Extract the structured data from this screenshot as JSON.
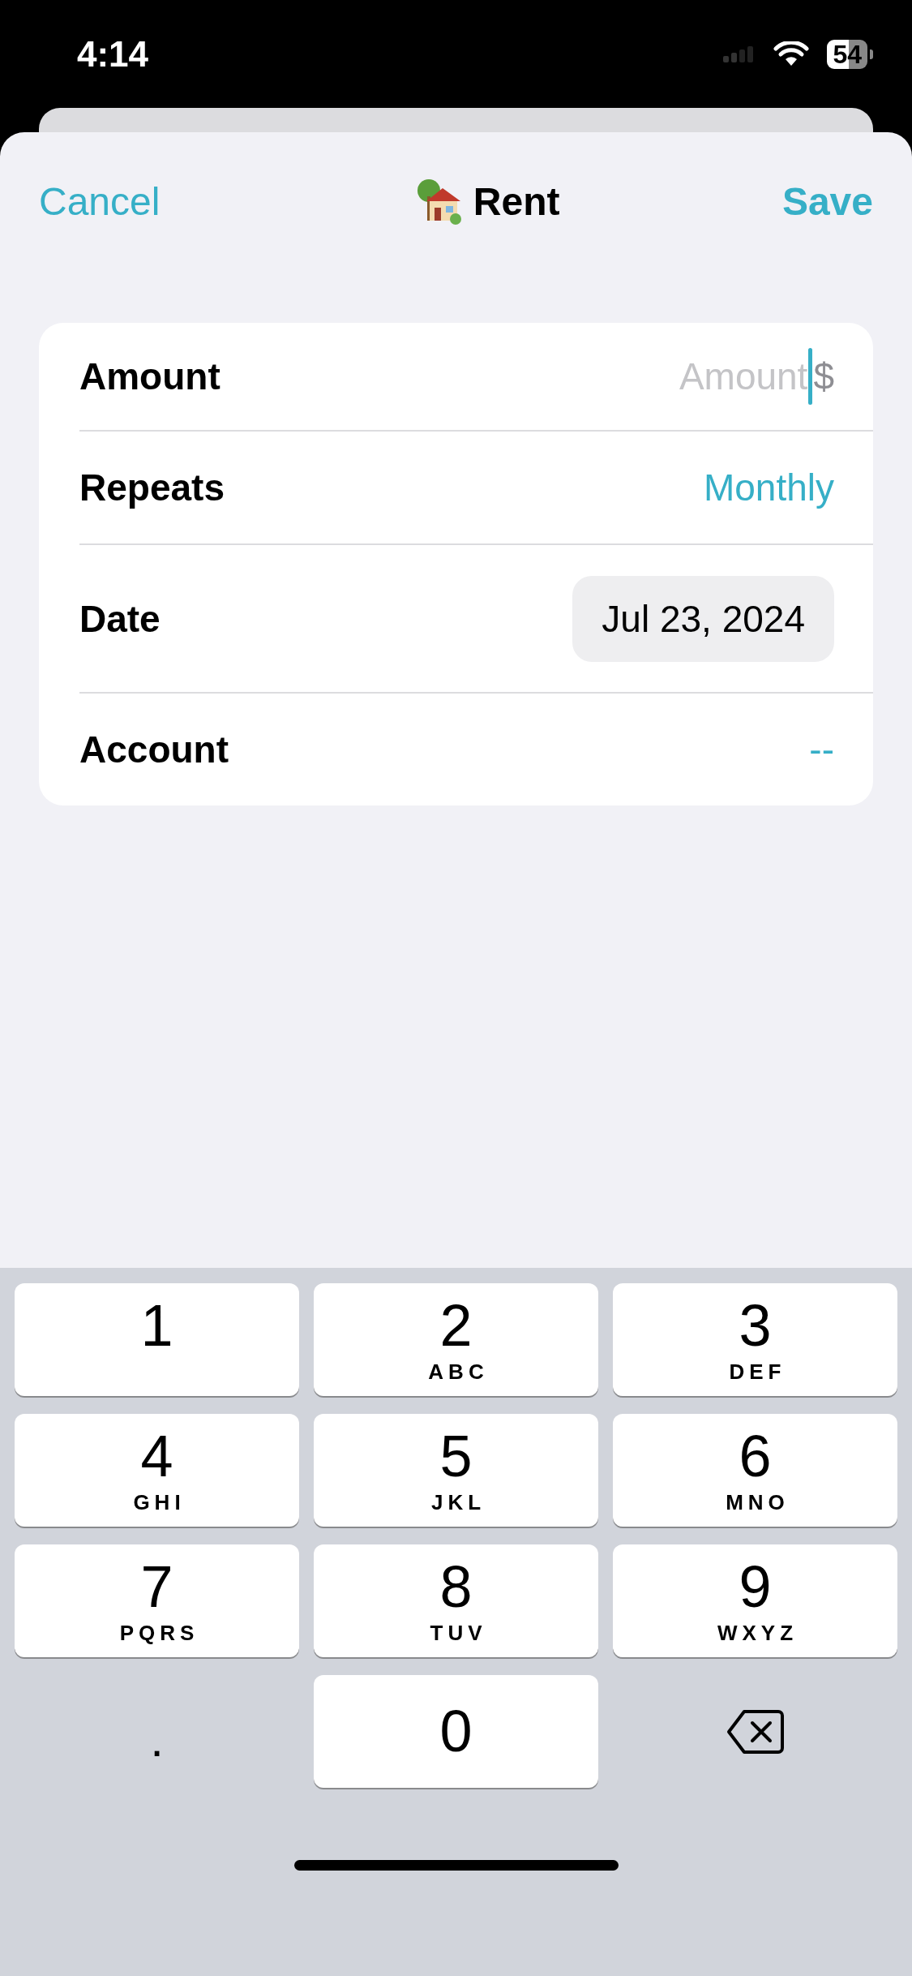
{
  "status_bar": {
    "time": "4:14",
    "battery": "54"
  },
  "nav": {
    "cancel": "Cancel",
    "title": "Rent",
    "save": "Save"
  },
  "form": [
    {
      "kind": "input",
      "label": "Amount",
      "placeholder": "Amount",
      "suffix": "$"
    },
    {
      "kind": "link",
      "label": "Repeats",
      "value": "Monthly"
    },
    {
      "kind": "date",
      "label": "Date",
      "value": "Jul 23, 2024"
    },
    {
      "kind": "link",
      "label": "Account",
      "value": "--"
    }
  ],
  "keypad_rows": [
    {
      "keys": [
        {
          "kind": "digit",
          "digit": "1"
        },
        {
          "kind": "digit",
          "digit": "2",
          "letters": "ABC"
        },
        {
          "kind": "digit",
          "digit": "3",
          "letters": "DEF"
        }
      ]
    },
    {
      "keys": [
        {
          "kind": "digit",
          "digit": "4",
          "letters": "GHI"
        },
        {
          "kind": "digit",
          "digit": "5",
          "letters": "JKL"
        },
        {
          "kind": "digit",
          "digit": "6",
          "letters": "MNO"
        }
      ]
    },
    {
      "keys": [
        {
          "kind": "digit",
          "digit": "7",
          "letters": "PQRS"
        },
        {
          "kind": "digit",
          "digit": "8",
          "letters": "TUV"
        },
        {
          "kind": "digit",
          "digit": "9",
          "letters": "WXYZ"
        }
      ]
    },
    {
      "keys": [
        {
          "kind": "plain",
          "digit": "."
        },
        {
          "kind": "digit",
          "digit": "0"
        },
        {
          "kind": "delete"
        }
      ]
    }
  ]
}
